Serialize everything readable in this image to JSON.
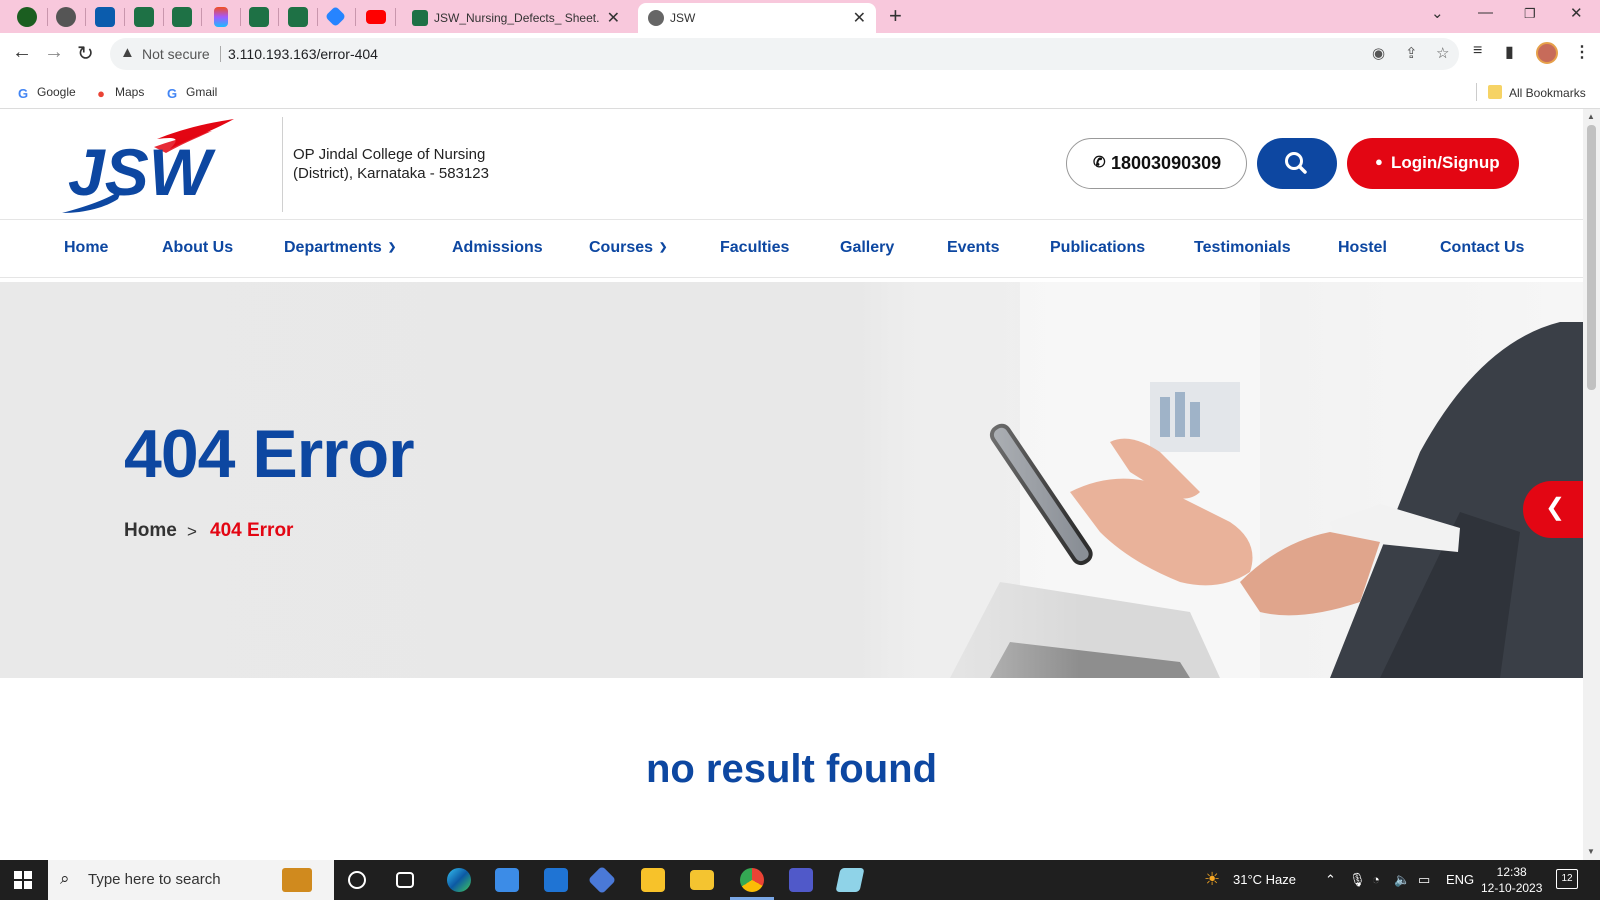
{
  "browser": {
    "tabs": [
      {
        "title": "JSW_Nursing_Defects_ Sheet.xlsx",
        "icon": "excel-icon",
        "active": false
      },
      {
        "title": "JSW",
        "icon": "globe-icon",
        "active": true
      }
    ],
    "pinned_icons": [
      "tab-icon",
      "globe-icon",
      "outlook-icon",
      "excel-icon",
      "excel-icon",
      "figma-icon",
      "excel-icon",
      "excel-icon",
      "jira-icon",
      "youtube-icon"
    ],
    "security_label": "Not secure",
    "url": "3.110.193.163/error-404",
    "bookmarks": [
      {
        "label": "Google",
        "icon": "google-icon"
      },
      {
        "label": "Maps",
        "icon": "maps-icon"
      },
      {
        "label": "Gmail",
        "icon": "google-icon"
      }
    ],
    "all_bookmarks_label": "All Bookmarks"
  },
  "site": {
    "logo_text": "JSW",
    "college_line1": "OP Jindal College of Nursing",
    "college_line2": "(District), Karnataka - 583123",
    "phone": "18003090309",
    "login_label": "Login/Signup",
    "brand_blue": "#0d47a1",
    "brand_red": "#e30613"
  },
  "nav": {
    "home": "Home",
    "about": "About Us",
    "departments": "Departments",
    "admissions": "Admissions",
    "courses": "Courses",
    "faculties": "Faculties",
    "gallery": "Gallery",
    "events": "Events",
    "publications": "Publications",
    "testimonials": "Testimonials",
    "hostel": "Hostel",
    "contact": "Contact Us"
  },
  "hero": {
    "title": "404 Error",
    "breadcrumb_home": "Home",
    "breadcrumb_sep": ">",
    "breadcrumb_current": "404 Error"
  },
  "content": {
    "message": "no result found"
  },
  "taskbar": {
    "search_placeholder": "Type here to search",
    "weather": "31°C  Haze",
    "language": "ENG",
    "time": "12:38",
    "date": "12-10-2023",
    "notification_count": "12"
  }
}
